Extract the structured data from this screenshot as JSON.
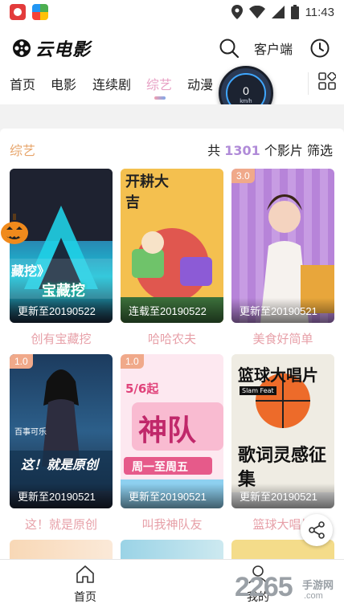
{
  "status_bar": {
    "time": "11:43"
  },
  "app": {
    "logo_text": "云电影"
  },
  "header": {
    "client_label": "客户端"
  },
  "tabs": [
    {
      "label": "首页"
    },
    {
      "label": "电影"
    },
    {
      "label": "连续剧"
    },
    {
      "label": "综艺",
      "active": true
    },
    {
      "label": "动漫"
    }
  ],
  "speed_widget": {
    "value": "0",
    "unit": "km/h"
  },
  "section": {
    "title": "综艺",
    "prefix": "共",
    "count": "1301",
    "suffix": "个影片",
    "filter_label": "筛选"
  },
  "cards": [
    {
      "title": "创有宝藏挖",
      "update": "更新至20190522",
      "overlay_text": "藏挖》",
      "overlay_text2": "宝藏挖"
    },
    {
      "title": "哈哈农夫",
      "update": "连载至20190522",
      "overlay_text": "开耕大吉"
    },
    {
      "title": "美食好简单",
      "update": "更新至20190521",
      "score": "3.0"
    },
    {
      "title": "这！就是原创",
      "update": "更新至20190521",
      "score": "1.0",
      "overlay_text": "这！就是原创",
      "brand_text": "百事可乐"
    },
    {
      "title": "叫我神队友",
      "update": "更新至20190521",
      "score": "1.0",
      "overlay_text": "神队",
      "overlay_text2": "5/6起",
      "overlay_text3": "周一至周五"
    },
    {
      "title": "篮球大唱片",
      "update": "更新至20190521",
      "overlay_text": "篮球大唱片",
      "overlay_text2": "歌词灵感征集",
      "brand_text": "Slam Feat"
    }
  ],
  "bottom_nav": [
    {
      "label": "首页"
    },
    {
      "label": "我的"
    }
  ],
  "watermark": {
    "text": "2265",
    "sub": "手游网",
    "domain": ".com"
  },
  "colors": {
    "accent_pink": "#e7a0c4",
    "section_orange": "#e7a46a",
    "count_purple": "#b08bd8",
    "score_badge": "#f0a98a"
  }
}
